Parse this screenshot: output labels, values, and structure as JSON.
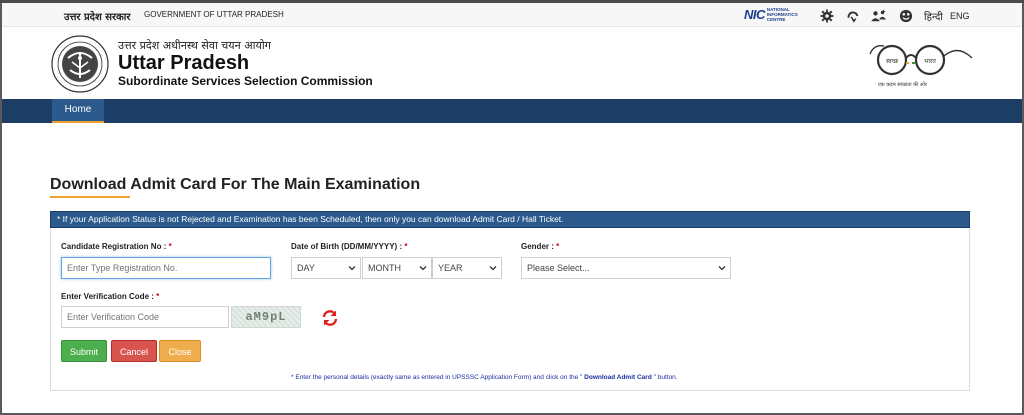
{
  "topbar": {
    "gov_hindi": "उत्तर प्रदेश सरकार",
    "gov_english": "GOVERNMENT OF UTTAR PRADESH",
    "nic_logo": "NIC",
    "nic_text_1": "NATIONAL",
    "nic_text_2": "INFORMATICS",
    "nic_text_3": "CENTRE",
    "icons": [
      "gear-icon",
      "screen-reader-icon",
      "font-size-icon",
      "contrast-icon"
    ],
    "lang_hindi": "हिन्दी",
    "lang_english": "ENG"
  },
  "header": {
    "hindi_name": "उत्तर प्रदेश अधीनस्थ सेवा चयन आयोग",
    "title": "Uttar Pradesh",
    "subtitle": "Subordinate Services Selection Commission",
    "swachh_left": "स्वच्छ",
    "swachh_right": "भारत",
    "swachh_tagline": "एक कदम स्वच्छता की ओर"
  },
  "nav": {
    "home": "Home"
  },
  "page": {
    "title": "Download Admit Card For The Main Examination",
    "notice": "* If your Application Status is not Rejected and Examination has been Scheduled, then only you can download Admit Card / Hall Ticket."
  },
  "form": {
    "reg_label": "Candidate Registration No : ",
    "reg_placeholder": "Enter Type Registration No.",
    "dob_label": "Date of Birth (DD/MM/YYYY) : ",
    "day": "DAY",
    "month": "MONTH",
    "year": "YEAR",
    "gender_label": "Gender : ",
    "gender_placeholder": "Please Select...",
    "verify_label": "Enter Verification Code : ",
    "verify_placeholder": "Enter Verification Code",
    "captcha": "aM9pL",
    "required_mark": "*",
    "submit": "Submit",
    "cancel": "Cancel",
    "close": "Close",
    "note_pre": "* Enter the personal details (exactly same as entered in UPSSSC Application Form) and click on the \"",
    "note_bold": " Download Admit Card ",
    "note_post": "\" button."
  },
  "colors": {
    "nav": "#1c3d65",
    "accent": "#f0a030",
    "notice": "#2c5a8c",
    "submit": "#4cae4c",
    "cancel": "#d9534f",
    "close": "#f0ad4e"
  }
}
